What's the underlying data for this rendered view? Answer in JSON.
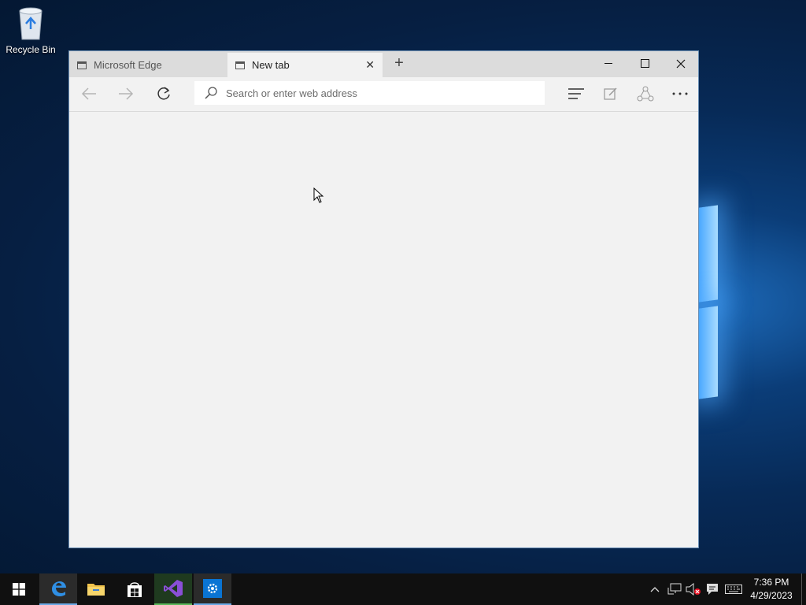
{
  "desktop": {
    "recycle_bin_label": "Recycle Bin"
  },
  "browser": {
    "tabs": [
      {
        "title": "Microsoft Edge",
        "active": false
      },
      {
        "title": "New tab",
        "active": true
      }
    ],
    "new_tab_symbol": "+",
    "close_tab_symbol": "✕",
    "address_placeholder": "Search or enter web address",
    "toolbar_icons": [
      "back-icon",
      "forward-icon",
      "refresh-icon",
      "hub-icon",
      "web-note-icon",
      "share-icon",
      "more-icon"
    ],
    "window_controls": [
      "minimize",
      "maximize",
      "close"
    ]
  },
  "taskbar": {
    "pinned": [
      {
        "name": "start",
        "icon": "windows-logo-icon"
      },
      {
        "name": "edge",
        "icon": "edge-icon",
        "active": true
      },
      {
        "name": "file-explorer",
        "icon": "folder-icon"
      },
      {
        "name": "store",
        "icon": "store-icon"
      },
      {
        "name": "visual-studio",
        "icon": "visual-studio-icon",
        "active": true
      },
      {
        "name": "settings-app",
        "icon": "gear-icon",
        "active": true
      }
    ],
    "clock": {
      "time": "7:36 PM",
      "date": "4/29/2023"
    }
  },
  "colors": {
    "window_bg": "#f2f2f2",
    "titlebar_bg": "#dcdcdc",
    "taskbar_bg": "#101010",
    "accent": "#0078d7"
  }
}
